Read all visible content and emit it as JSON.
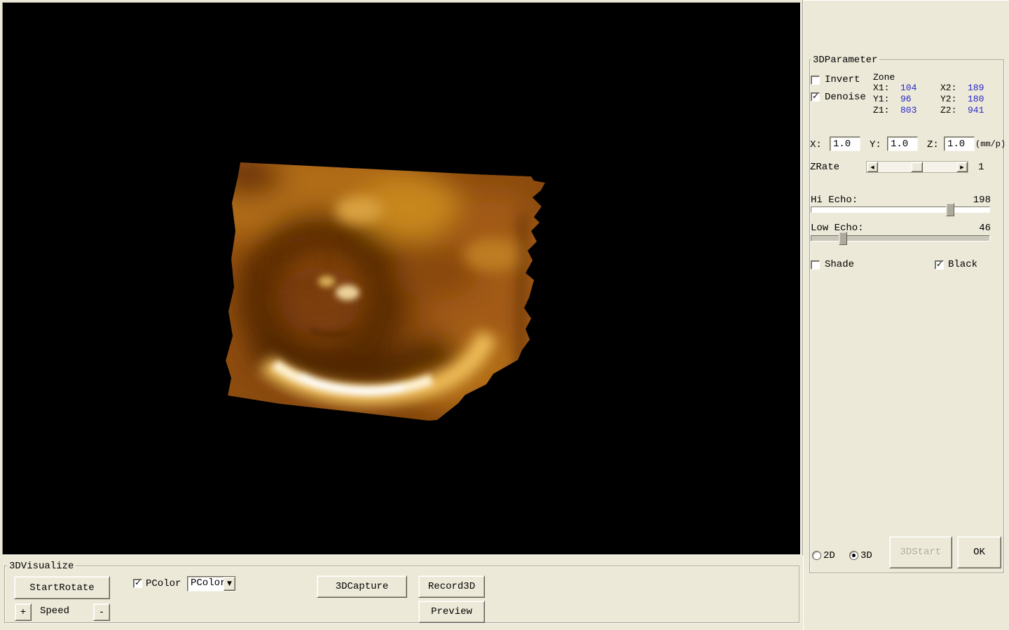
{
  "colors": {
    "background": "#ece9d8",
    "viewport_bg": "#000000",
    "zone_value_text": "#2626c9",
    "render_amber": "#8a4a0e",
    "render_highlight": "#fff3d4"
  },
  "parameter_panel": {
    "title": "3DParameter",
    "invert": {
      "label": "Invert",
      "checked": false
    },
    "denoise": {
      "label": "Denoise",
      "checked": true
    },
    "zone": {
      "label": "Zone",
      "rows": [
        {
          "l1": "X1:",
          "v1": "104",
          "l2": "X2:",
          "v2": "189"
        },
        {
          "l1": "Y1:",
          "v1": "96",
          "l2": "Y2:",
          "v2": "180"
        },
        {
          "l1": "Z1:",
          "v1": "803",
          "l2": "Z2:",
          "v2": "941"
        }
      ]
    },
    "scale": {
      "x_label": "X:",
      "x_value": "1.0",
      "y_label": "Y:",
      "y_value": "1.0",
      "z_label": "Z:",
      "z_value": "1.0",
      "unit": "(mm/p)"
    },
    "zrate": {
      "label": "ZRate",
      "value": "1"
    },
    "hi_echo": {
      "label": "Hi Echo:",
      "value": "198"
    },
    "low_echo": {
      "label": "Low Echo:",
      "value": "46"
    },
    "shade": {
      "label": "Shade",
      "checked": false
    },
    "black": {
      "label": "Black",
      "checked": true
    },
    "modes": {
      "mode_2d": {
        "label": "2D",
        "selected": false
      },
      "mode_3d": {
        "label": "3D",
        "selected": true
      }
    },
    "buttons": {
      "start": "3DStart",
      "ok": "OK"
    }
  },
  "visualize_panel": {
    "title": "3DVisualize",
    "buttons": {
      "start_rotate": "StartRotate",
      "speed_plus": "+",
      "speed_minus": "-",
      "capture": "3DCapture",
      "record": "Record3D",
      "preview": "Preview"
    },
    "speed_label": "Speed",
    "pcolor_checkbox": {
      "label": "PColor",
      "checked": true
    },
    "pcolor_combo": {
      "value": "PColor"
    }
  }
}
